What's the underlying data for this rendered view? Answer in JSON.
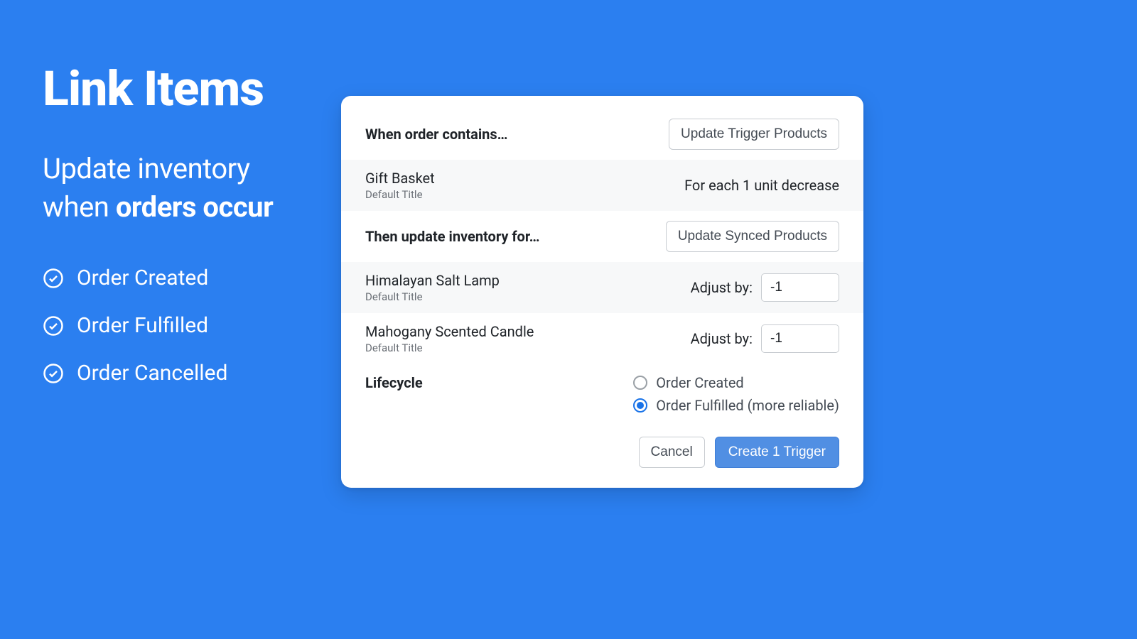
{
  "left": {
    "title": "Link Items",
    "subtitle_prefix": "Update inventory when ",
    "subtitle_bold": "orders occur",
    "checks": [
      {
        "label": "Order Created"
      },
      {
        "label": "Order Fulfilled"
      },
      {
        "label": "Order Cancelled"
      }
    ]
  },
  "panel": {
    "when_label": "When order contains…",
    "update_trigger_btn": "Update Trigger Products",
    "trigger_product": {
      "title": "Gift Basket",
      "variant": "Default Title",
      "rule": "For each 1 unit decrease"
    },
    "then_label": "Then update inventory for…",
    "update_synced_btn": "Update Synced Products",
    "synced": [
      {
        "title": "Himalayan Salt Lamp",
        "variant": "Default Title",
        "adjust_label": "Adjust by:",
        "adjust_value": "-1"
      },
      {
        "title": "Mahogany Scented Candle",
        "variant": "Default Title",
        "adjust_label": "Adjust by:",
        "adjust_value": "-1"
      }
    ],
    "lifecycle_label": "Lifecycle",
    "lifecycle_options": [
      {
        "label": "Order Created",
        "selected": false
      },
      {
        "label": "Order Fulfilled (more reliable)",
        "selected": true
      }
    ],
    "cancel_btn": "Cancel",
    "create_btn": "Create 1 Trigger"
  }
}
